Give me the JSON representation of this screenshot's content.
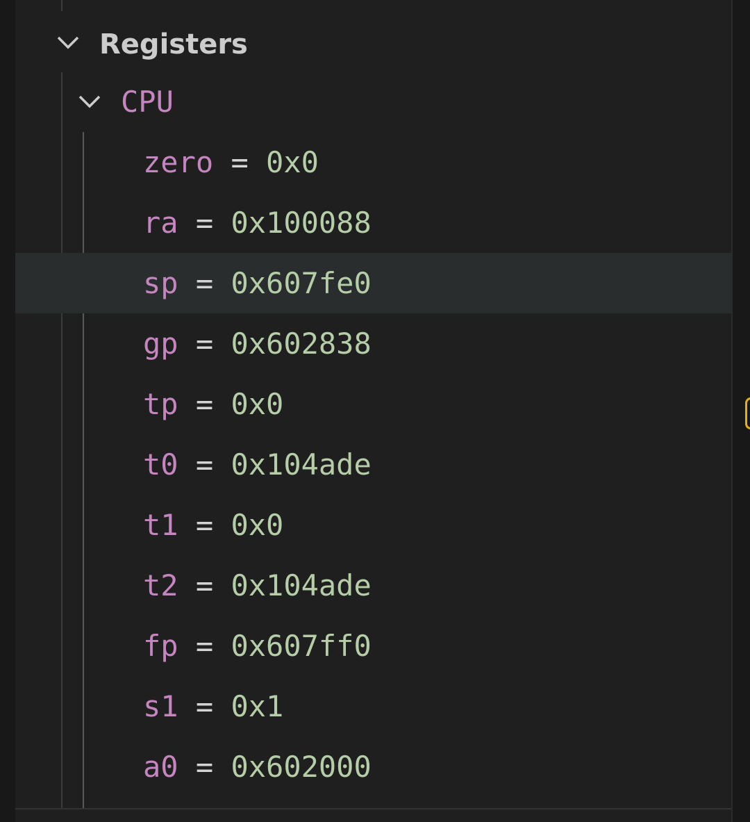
{
  "colors": {
    "background": "#1f1f1f",
    "register_name": "#c586c0",
    "register_value": "#b5cea8",
    "section_title": "#cccccc",
    "selected_row": "#2a2d2e",
    "scroll_marker": "#e5b10a"
  },
  "registers_section": {
    "title": "Registers",
    "expanded": true,
    "icon": "chevron-down-icon"
  },
  "cpu_group": {
    "title": "CPU",
    "expanded": true,
    "icon": "chevron-down-icon"
  },
  "separator": "=",
  "registers": [
    {
      "name": "zero",
      "value": "0x0"
    },
    {
      "name": "ra",
      "value": "0x100088"
    },
    {
      "name": "sp",
      "value": "0x607fe0",
      "selected": true
    },
    {
      "name": "gp",
      "value": "0x602838"
    },
    {
      "name": "tp",
      "value": "0x0"
    },
    {
      "name": "t0",
      "value": "0x104ade"
    },
    {
      "name": "t1",
      "value": "0x0"
    },
    {
      "name": "t2",
      "value": "0x104ade"
    },
    {
      "name": "fp",
      "value": "0x607ff0"
    },
    {
      "name": "s1",
      "value": "0x1"
    },
    {
      "name": "a0",
      "value": "0x602000"
    }
  ]
}
